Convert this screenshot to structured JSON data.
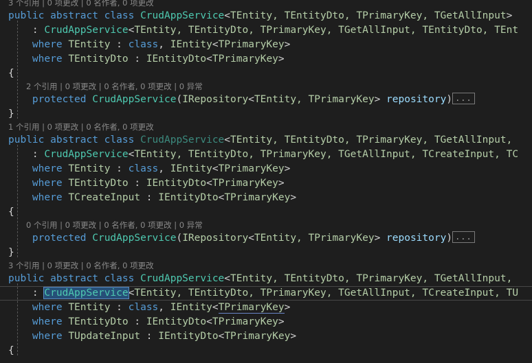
{
  "app": {
    "kind": "code-editor",
    "language": "csharp",
    "theme": "dark",
    "colors": {
      "background": "#1e1e1e",
      "foreground": "#d4d4d4",
      "keyword": "#569cd6",
      "type": "#4ec9b0",
      "type_faded": "#3c8a7e",
      "generic_type": "#b5cea8",
      "parameter": "#9cdcfe",
      "codelens": "#8a8a8a",
      "selection_background": "#264f78",
      "selection_border": "#5a8ac0",
      "current_line_border": "#474747",
      "indent_guide": "#585858",
      "fold_box_border": "#7a7a7a",
      "reference_underline": "#6a86c8"
    }
  },
  "editor": {
    "blocks": [
      {
        "id": "block-1",
        "codelens": {
          "truncated": true,
          "references": "3 个引用",
          "changes": "0 项更改",
          "authors": "0 名作者, 0 项更改",
          "exceptions": null,
          "text": "3 个引用 | 0 项更改 | 0 名作者, 0 项更改"
        },
        "lines": [
          {
            "id": "b1-l1",
            "segments": [
              {
                "t": "public abstract class ",
                "c": "kw"
              },
              {
                "t": "CrudAppService",
                "c": "type"
              },
              {
                "t": "<",
                "c": "punc"
              },
              {
                "t": "TEntity, TEntityDto, TPrimaryKey, TGetAllInput",
                "c": "gtype"
              },
              {
                "t": ">",
                "c": "punc"
              }
            ]
          },
          {
            "id": "b1-l2",
            "segments": [
              {
                "t": "    : ",
                "c": "punc"
              },
              {
                "t": "CrudAppService",
                "c": "type"
              },
              {
                "t": "<",
                "c": "punc"
              },
              {
                "t": "TEntity, TEntityDto, TPrimaryKey, TGetAllInput, TEntityDto, TEnt",
                "c": "gtype"
              }
            ]
          },
          {
            "id": "b1-l3",
            "segments": [
              {
                "t": "    ",
                "c": "punc"
              },
              {
                "t": "where",
                "c": "kw"
              },
              {
                "t": " ",
                "c": "punc"
              },
              {
                "t": "TEntity",
                "c": "gtype"
              },
              {
                "t": " : ",
                "c": "punc"
              },
              {
                "t": "class",
                "c": "kw"
              },
              {
                "t": ", ",
                "c": "punc"
              },
              {
                "t": "IEntity",
                "c": "gtype"
              },
              {
                "t": "<",
                "c": "punc"
              },
              {
                "t": "TPrimaryKey",
                "c": "gtype"
              },
              {
                "t": ">",
                "c": "punc"
              }
            ]
          },
          {
            "id": "b1-l4",
            "segments": [
              {
                "t": "    ",
                "c": "punc"
              },
              {
                "t": "where",
                "c": "kw"
              },
              {
                "t": " ",
                "c": "punc"
              },
              {
                "t": "TEntityDto",
                "c": "gtype"
              },
              {
                "t": " : ",
                "c": "punc"
              },
              {
                "t": "IEntityDto",
                "c": "gtype"
              },
              {
                "t": "<",
                "c": "punc"
              },
              {
                "t": "TPrimaryKey",
                "c": "gtype"
              },
              {
                "t": ">",
                "c": "punc"
              }
            ]
          },
          {
            "id": "b1-l5",
            "segments": [
              {
                "t": "{",
                "c": "brace"
              }
            ]
          }
        ],
        "member_codelens": {
          "text": "2 个引用 | 0 项更改 | 0 名作者, 0 项更改 | 0 异常",
          "references": "2 个引用",
          "changes": "0 项更改",
          "authors": "0 名作者, 0 项更改",
          "exceptions": "0 异常"
        },
        "member_line": {
          "id": "b1-ctor",
          "segments": [
            {
              "t": "    ",
              "c": "punc"
            },
            {
              "t": "protected",
              "c": "kw"
            },
            {
              "t": " ",
              "c": "punc"
            },
            {
              "t": "CrudAppService",
              "c": "type"
            },
            {
              "t": "(",
              "c": "punc"
            },
            {
              "t": "IRepository",
              "c": "gtype"
            },
            {
              "t": "<",
              "c": "punc"
            },
            {
              "t": "TEntity, TPrimaryKey",
              "c": "gtype"
            },
            {
              "t": "> ",
              "c": "punc"
            },
            {
              "t": "repository",
              "c": "param"
            },
            {
              "t": ")",
              "c": "punc"
            }
          ],
          "fold_label": "..."
        },
        "close_brace": "}"
      },
      {
        "id": "block-2",
        "codelens": {
          "text": "1 个引用 | 0 项更改 | 0 名作者, 0 项更改",
          "references": "1 个引用",
          "changes": "0 项更改",
          "authors": "0 名作者, 0 项更改",
          "exceptions": null
        },
        "lines": [
          {
            "id": "b2-l1",
            "segments": [
              {
                "t": "public abstract class ",
                "c": "kw"
              },
              {
                "t": "CrudAppService",
                "c": "type-dim"
              },
              {
                "t": "<",
                "c": "punc"
              },
              {
                "t": "TEntity, TEntityDto, TPrimaryKey, TGetAllInput,",
                "c": "gtype"
              }
            ]
          },
          {
            "id": "b2-l2",
            "segments": [
              {
                "t": "    : ",
                "c": "punc"
              },
              {
                "t": "CrudAppService",
                "c": "type"
              },
              {
                "t": "<",
                "c": "punc"
              },
              {
                "t": "TEntity, TEntityDto, TPrimaryKey, TGetAllInput, TCreateInput, TC",
                "c": "gtype"
              }
            ]
          },
          {
            "id": "b2-l3",
            "segments": [
              {
                "t": "    ",
                "c": "punc"
              },
              {
                "t": "where",
                "c": "kw"
              },
              {
                "t": " ",
                "c": "punc"
              },
              {
                "t": "TEntity",
                "c": "gtype"
              },
              {
                "t": " : ",
                "c": "punc"
              },
              {
                "t": "class",
                "c": "kw"
              },
              {
                "t": ", ",
                "c": "punc"
              },
              {
                "t": "IEntity",
                "c": "gtype"
              },
              {
                "t": "<",
                "c": "punc"
              },
              {
                "t": "TPrimaryKey",
                "c": "gtype"
              },
              {
                "t": ">",
                "c": "punc"
              }
            ]
          },
          {
            "id": "b2-l4",
            "segments": [
              {
                "t": "    ",
                "c": "punc"
              },
              {
                "t": "where",
                "c": "kw"
              },
              {
                "t": " ",
                "c": "punc"
              },
              {
                "t": "TEntityDto",
                "c": "gtype"
              },
              {
                "t": " : ",
                "c": "punc"
              },
              {
                "t": "IEntityDto",
                "c": "gtype"
              },
              {
                "t": "<",
                "c": "punc"
              },
              {
                "t": "TPrimaryKey",
                "c": "gtype"
              },
              {
                "t": ">",
                "c": "punc"
              }
            ]
          },
          {
            "id": "b2-l5",
            "segments": [
              {
                "t": "    ",
                "c": "punc"
              },
              {
                "t": "where",
                "c": "kw"
              },
              {
                "t": " ",
                "c": "punc"
              },
              {
                "t": "TCreateInput",
                "c": "gtype"
              },
              {
                "t": " : ",
                "c": "punc"
              },
              {
                "t": "IEntityDto",
                "c": "gtype"
              },
              {
                "t": "<",
                "c": "punc"
              },
              {
                "t": "TPrimaryKey",
                "c": "gtype"
              },
              {
                "t": ">",
                "c": "punc"
              }
            ]
          },
          {
            "id": "b2-l6",
            "segments": [
              {
                "t": "{",
                "c": "brace"
              }
            ]
          }
        ],
        "member_codelens": {
          "text": "0 个引用 | 0 项更改 | 0 名作者, 0 项更改 | 0 异常",
          "references": "0 个引用",
          "changes": "0 项更改",
          "authors": "0 名作者, 0 项更改",
          "exceptions": "0 异常"
        },
        "member_line": {
          "id": "b2-ctor",
          "segments": [
            {
              "t": "    ",
              "c": "punc"
            },
            {
              "t": "protected",
              "c": "kw"
            },
            {
              "t": " ",
              "c": "punc"
            },
            {
              "t": "CrudAppService",
              "c": "type"
            },
            {
              "t": "(",
              "c": "punc"
            },
            {
              "t": "IRepository",
              "c": "gtype"
            },
            {
              "t": "<",
              "c": "punc"
            },
            {
              "t": "TEntity, TPrimaryKey",
              "c": "gtype"
            },
            {
              "t": "> ",
              "c": "punc"
            },
            {
              "t": "repository",
              "c": "param"
            },
            {
              "t": ")",
              "c": "punc"
            }
          ],
          "fold_label": "..."
        },
        "close_brace": "}"
      },
      {
        "id": "block-3",
        "codelens": {
          "text": "3 个引用 | 0 项更改 | 0 名作者, 0 项更改",
          "references": "3 个引用",
          "changes": "0 项更改",
          "authors": "0 名作者, 0 项更改",
          "exceptions": null
        },
        "lines": [
          {
            "id": "b3-l1",
            "segments": [
              {
                "t": "public abstract class ",
                "c": "kw"
              },
              {
                "t": "CrudAppService",
                "c": "type"
              },
              {
                "t": "<",
                "c": "punc"
              },
              {
                "t": "TEntity, TEntityDto, TPrimaryKey, TGetAllInput,",
                "c": "gtype"
              }
            ]
          },
          {
            "id": "b3-l2",
            "current": true,
            "segments": [
              {
                "t": "    : ",
                "c": "punc"
              },
              {
                "t": "CrudAppService",
                "c": "type",
                "sel": true
              },
              {
                "t": "<",
                "c": "punc"
              },
              {
                "t": "TEntity, TEntityDto, TPrimaryKey, TGetAllInput, TCreateInput, TU",
                "c": "gtype"
              }
            ]
          },
          {
            "id": "b3-l3",
            "segments": [
              {
                "t": "    ",
                "c": "punc"
              },
              {
                "t": "where",
                "c": "kw"
              },
              {
                "t": " ",
                "c": "punc"
              },
              {
                "t": "TEntity",
                "c": "gtype"
              },
              {
                "t": " : ",
                "c": "punc"
              },
              {
                "t": "class",
                "c": "kw"
              },
              {
                "t": ", ",
                "c": "punc"
              },
              {
                "t": "IEntity",
                "c": "gtype"
              },
              {
                "t": "<",
                "c": "punc"
              },
              {
                "t": "TPrimaryKey",
                "c": "gtype",
                "underline": true
              },
              {
                "t": ">",
                "c": "punc"
              }
            ]
          },
          {
            "id": "b3-l4",
            "segments": [
              {
                "t": "    ",
                "c": "punc"
              },
              {
                "t": "where",
                "c": "kw"
              },
              {
                "t": " ",
                "c": "punc"
              },
              {
                "t": "TEntityDto",
                "c": "gtype"
              },
              {
                "t": " : ",
                "c": "punc"
              },
              {
                "t": "IEntityDto",
                "c": "gtype"
              },
              {
                "t": "<",
                "c": "punc"
              },
              {
                "t": "TPrimaryKey",
                "c": "gtype"
              },
              {
                "t": ">",
                "c": "punc"
              }
            ]
          },
          {
            "id": "b3-l5",
            "segments": [
              {
                "t": "    ",
                "c": "punc"
              },
              {
                "t": "where",
                "c": "kw"
              },
              {
                "t": " ",
                "c": "punc"
              },
              {
                "t": "TUpdateInput",
                "c": "gtype"
              },
              {
                "t": " : ",
                "c": "punc"
              },
              {
                "t": "IEntityDto",
                "c": "gtype"
              },
              {
                "t": "<",
                "c": "punc"
              },
              {
                "t": "TPrimaryKey",
                "c": "gtype"
              },
              {
                "t": ">",
                "c": "punc"
              }
            ]
          },
          {
            "id": "b3-l6",
            "segments": [
              {
                "t": "{",
                "c": "brace"
              }
            ]
          }
        ]
      }
    ],
    "selection": {
      "text": "CrudAppService",
      "line_id": "b3-l2"
    }
  }
}
